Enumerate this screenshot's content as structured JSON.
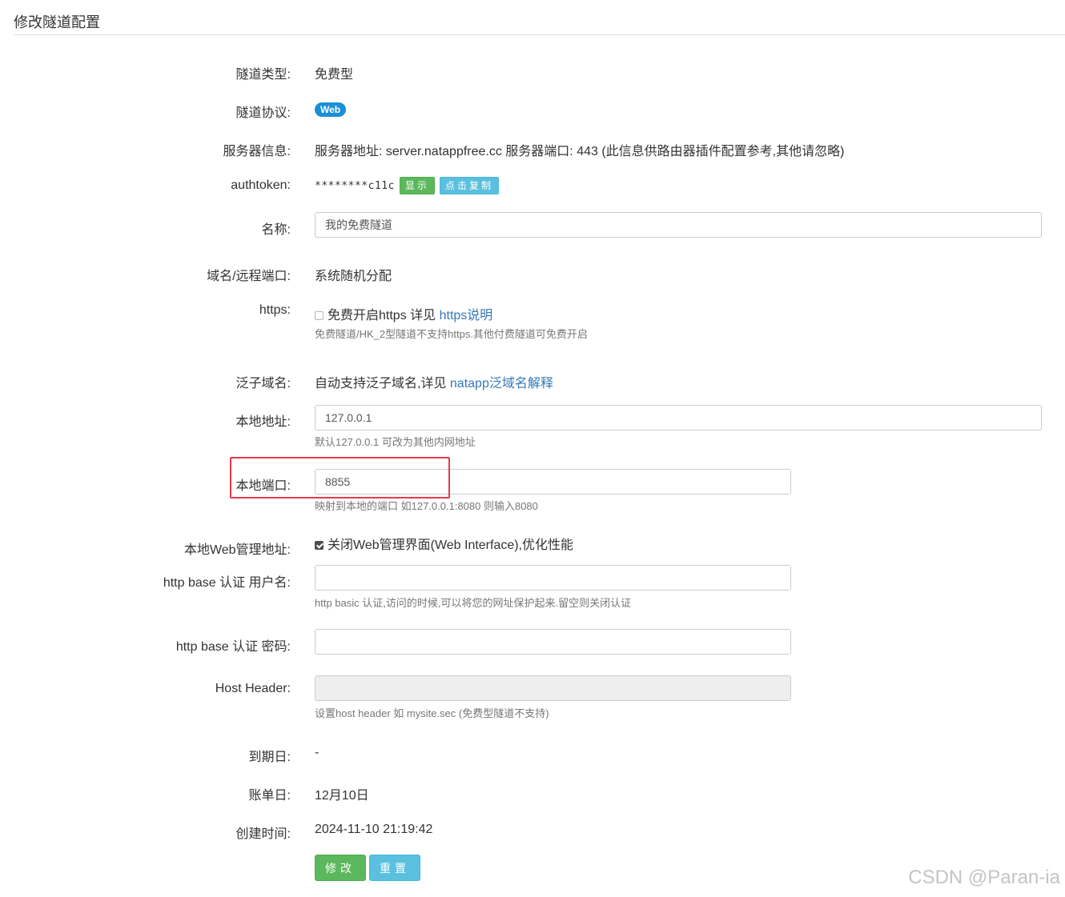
{
  "page": {
    "title": "修改隧道配置"
  },
  "form": {
    "tunnel_type": {
      "label": "隧道类型:",
      "value": "免费型"
    },
    "protocol": {
      "label": "隧道协议:",
      "badge": "Web"
    },
    "server_info": {
      "label": "服务器信息:",
      "value": "服务器地址: server.natappfree.cc 服务器端口: 443 (此信息供路由器插件配置参考,其他请忽略)"
    },
    "authtoken": {
      "label": "authtoken:",
      "value": "********c11c",
      "show_button": "显示",
      "copy_button": "点击复制"
    },
    "name": {
      "label": "名称:",
      "value": "我的免费隧道"
    },
    "domain": {
      "label": "域名/远程端口:",
      "value": "系统随机分配"
    },
    "https": {
      "label": "https:",
      "checkbox_text": "免费开启https 详见",
      "link": "https说明",
      "help": "免费隧道/HK_2型隧道不支持https.其他付费隧道可免费开启",
      "checked": false
    },
    "wildcard": {
      "label": "泛子域名:",
      "text": "自动支持泛子域名,详见",
      "link": "natapp泛域名解释"
    },
    "local_address": {
      "label": "本地地址:",
      "value": "127.0.0.1",
      "help": "默认127.0.0.1 可改为其他内网地址"
    },
    "local_port": {
      "label": "本地端口:",
      "value": "8855",
      "help": "映射到本地的端口 如127.0.0.1:8080 则输入8080"
    },
    "web_admin": {
      "label": "本地Web管理地址:",
      "checkbox_text": "关闭Web管理界面(Web Interface),优化性能",
      "checked": true
    },
    "auth_user": {
      "label": "http base 认证 用户名:",
      "value": "",
      "help": "http basic 认证,访问的时候,可以将您的网址保护起来.留空则关闭认证"
    },
    "auth_pass": {
      "label": "http base 认证 密码:",
      "value": ""
    },
    "host_header": {
      "label": "Host Header:",
      "value": "",
      "help": "设置host header 如 mysite.sec (免费型隧道不支持)"
    },
    "expire": {
      "label": "到期日:",
      "value": "-"
    },
    "billing": {
      "label": "账单日:",
      "value": "12月10日"
    },
    "created": {
      "label": "创建时间:",
      "value": "2024-11-10 21:19:42"
    }
  },
  "actions": {
    "submit": "修改",
    "reset": "重置"
  },
  "watermark": "CSDN @Paran-ia",
  "colors": {
    "badge": "#1a8fd6",
    "green": "#5cb85c",
    "cyan": "#5bc0de",
    "link": "#337ab7",
    "highlight": "#e8394a"
  }
}
